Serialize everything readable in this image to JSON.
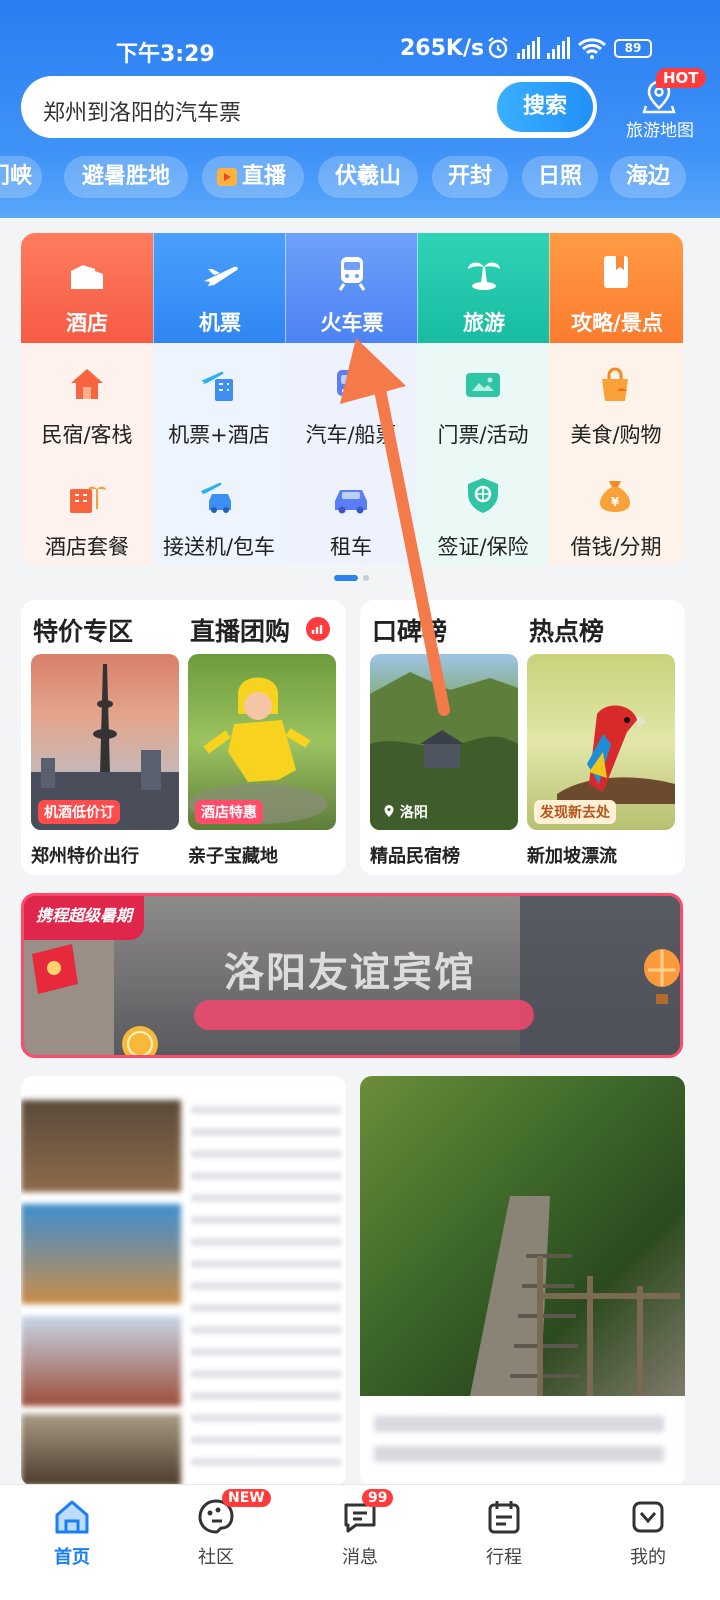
{
  "status_bar": {
    "time": "下午3:29",
    "speed": "265K/s",
    "battery": "89"
  },
  "search": {
    "query": "郑州到洛阳的汽车票",
    "button": "搜索"
  },
  "map": {
    "badge": "HOT",
    "label": "旅游地图"
  },
  "chips": [
    "门峡",
    "避暑胜地",
    "直播",
    "伏羲山",
    "开封",
    "日照",
    "海边"
  ],
  "grid": {
    "row1": [
      "酒店",
      "机票",
      "火车票",
      "旅游",
      "攻略/景点"
    ],
    "row2": [
      "民宿/客栈",
      "机票+酒店",
      "汽车/船票",
      "门票/活动",
      "美食/购物"
    ],
    "row3": [
      "酒店套餐",
      "接送机/包车",
      "租车",
      "签证/保险",
      "借钱/分期"
    ]
  },
  "lists": {
    "left": {
      "title1": "特价专区",
      "title2": "直播团购",
      "card1_tag": "机酒低价订",
      "card1_caption": "郑州特价出行",
      "card2_tag": "酒店特惠",
      "card2_caption": "亲子宝藏地"
    },
    "right": {
      "title1": "口碑榜",
      "title2": "热点榜",
      "card1_tag": "洛阳",
      "card1_caption": "精品民宿榜",
      "card2_tag": "发现新去处",
      "card2_caption": "新加坡漂流"
    }
  },
  "banner": {
    "badge": "携程超级暑期",
    "title": "洛阳友谊宾馆"
  },
  "tabbar": {
    "home": "首页",
    "community": "社区",
    "community_badge": "NEW",
    "messages": "消息",
    "messages_badge": "99",
    "trips": "行程",
    "mine": "我的"
  },
  "colors": {
    "header": "#2a7df2",
    "hotel": "#f96a4f",
    "flight": "#3d8ff5",
    "train": "#5b8cf7",
    "tour": "#21c4a8",
    "guide": "#fb8a3a",
    "arrow": "#f47a4a"
  }
}
